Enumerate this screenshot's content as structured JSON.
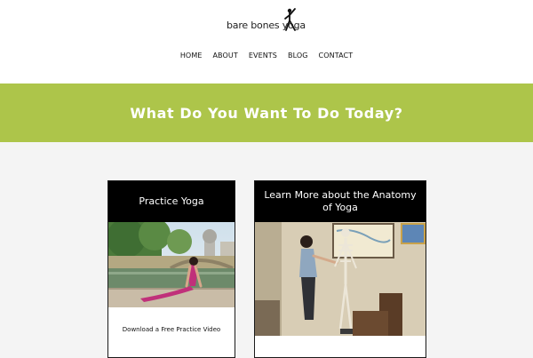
{
  "logo": {
    "text": "bare bones yoga"
  },
  "nav": {
    "items": [
      "HOME",
      "ABOUT",
      "EVENTS",
      "BLOG",
      "CONTACT"
    ]
  },
  "banner": {
    "heading": "What Do You Want To Do Today?"
  },
  "cards": [
    {
      "title": "Practice Yoga",
      "photo": "woman-in-upward-dog-pose-by-river-photo",
      "link": "Download a Free Practice Video"
    },
    {
      "title": "Learn More about the Anatomy of Yoga",
      "photo": "teacher-with-anatomical-skeleton-photo"
    }
  ],
  "colors": {
    "banner": "#adc54a",
    "card_header": "#000000",
    "page_background": "#f4f4f4"
  }
}
